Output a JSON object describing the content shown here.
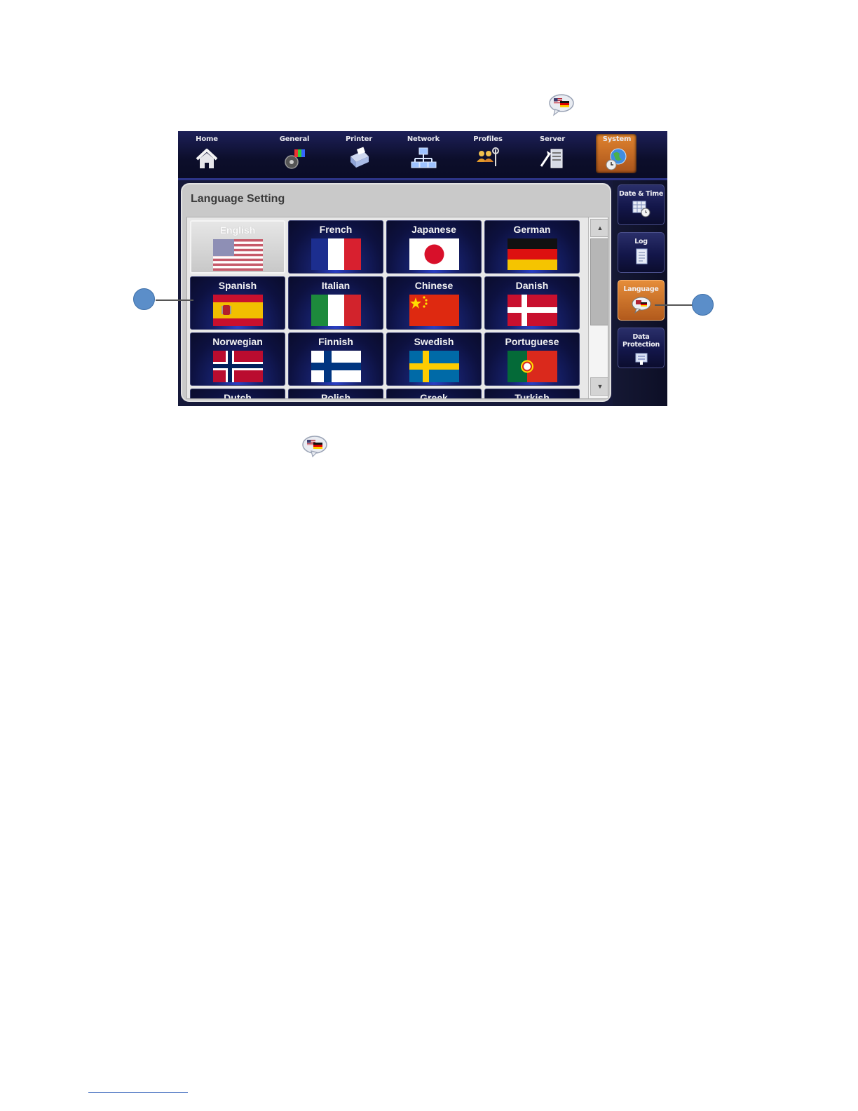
{
  "nav": {
    "items": [
      {
        "label": "Home",
        "icon": "home-icon"
      },
      {
        "label": "General",
        "icon": "general-icon"
      },
      {
        "label": "Printer",
        "icon": "printer-icon"
      },
      {
        "label": "Network",
        "icon": "network-icon"
      },
      {
        "label": "Profiles",
        "icon": "profiles-icon"
      },
      {
        "label": "Server",
        "icon": "server-icon"
      },
      {
        "label": "System",
        "icon": "system-icon",
        "active": true
      }
    ]
  },
  "side": {
    "items": [
      {
        "label": "Date & Time",
        "icon": "calendar-clock-icon"
      },
      {
        "label": "Log",
        "icon": "log-document-icon"
      },
      {
        "label": "Language",
        "icon": "language-bubble-icon",
        "active": true
      },
      {
        "label": "Data Protection",
        "icon": "data-protection-icon"
      }
    ]
  },
  "panel": {
    "title": "Language Setting"
  },
  "languages": [
    {
      "label": "English",
      "flag": "us-flag",
      "selected": true
    },
    {
      "label": "French",
      "flag": "france-flag"
    },
    {
      "label": "Japanese",
      "flag": "japan-flag"
    },
    {
      "label": "German",
      "flag": "germany-flag"
    },
    {
      "label": "Spanish",
      "flag": "spain-flag"
    },
    {
      "label": "Italian",
      "flag": "italy-flag"
    },
    {
      "label": "Chinese",
      "flag": "china-flag"
    },
    {
      "label": "Danish",
      "flag": "denmark-flag"
    },
    {
      "label": "Norwegian",
      "flag": "norway-flag"
    },
    {
      "label": "Finnish",
      "flag": "finland-flag"
    },
    {
      "label": "Swedish",
      "flag": "sweden-flag"
    },
    {
      "label": "Portuguese",
      "flag": "portugal-flag"
    },
    {
      "label": "Dutch",
      "flag": "netherlands-flag"
    },
    {
      "label": "Polish",
      "flag": "poland-flag"
    },
    {
      "label": "Greek",
      "flag": "greece-flag"
    },
    {
      "label": "Turkish",
      "flag": "turkey-flag"
    }
  ],
  "colors": {
    "accent_orange": "#d9782c",
    "nav_bg": "#0c0e2b",
    "callout": "#5b8ec9"
  }
}
